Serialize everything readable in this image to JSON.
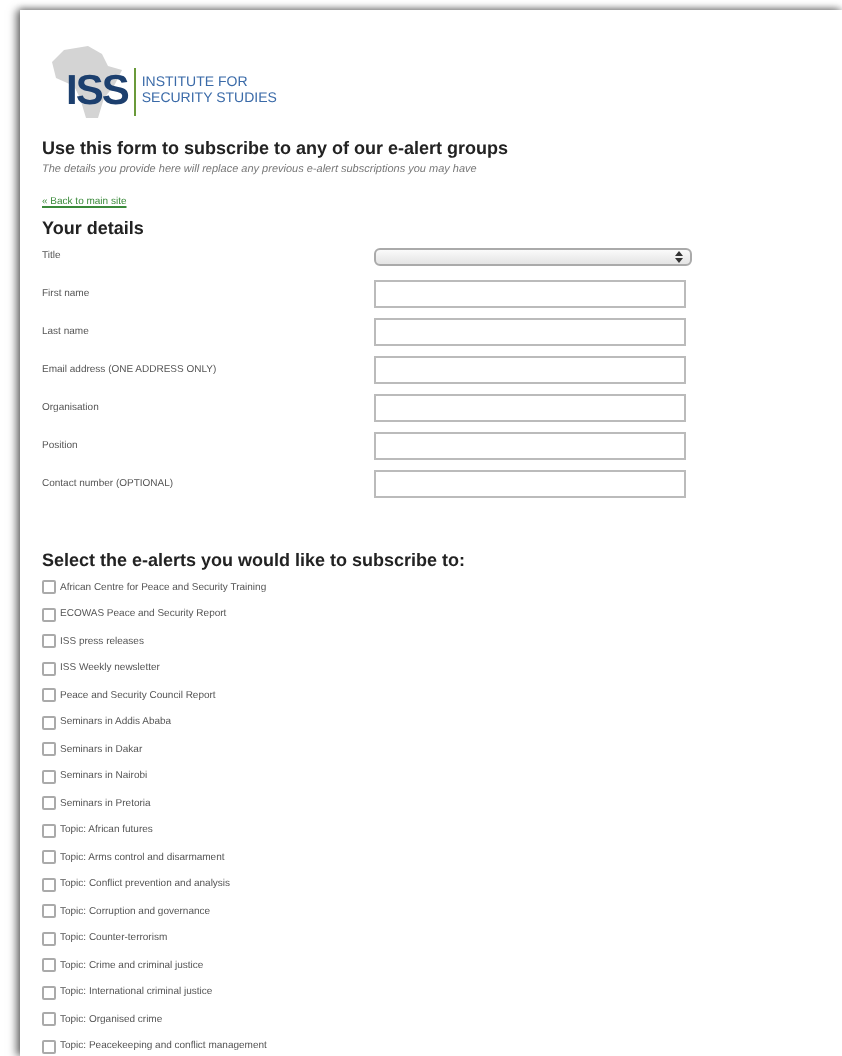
{
  "logo": {
    "abbr": "ISS",
    "line1": "INSTITUTE FOR",
    "line2": "SECURITY STUDIES"
  },
  "heading": "Use this form to subscribe to any of our e-alert groups",
  "intro": "The details you provide here will replace any previous e-alert subscriptions you may have",
  "back_link": "« Back to main site",
  "details_heading": "Your details",
  "fields": [
    {
      "label": "Title",
      "kind": "select"
    },
    {
      "label": "First name",
      "kind": "text"
    },
    {
      "label": "Last name",
      "kind": "text"
    },
    {
      "label": "Email address (ONE ADDRESS ONLY)",
      "kind": "text"
    },
    {
      "label": "Organisation",
      "kind": "text"
    },
    {
      "label": "Position",
      "kind": "text"
    },
    {
      "label": "Contact number (OPTIONAL)",
      "kind": "text"
    }
  ],
  "alerts_heading": "Select the e-alerts you would like to subscribe to:",
  "alerts": [
    {
      "label": "African Centre for Peace and Security Training",
      "checked": false
    },
    {
      "label": "ECOWAS Peace and Security Report",
      "checked": false
    },
    {
      "label": "ISS press releases",
      "checked": false
    },
    {
      "label": "ISS Weekly newsletter",
      "checked": false
    },
    {
      "label": "Peace and Security Council Report",
      "checked": false
    },
    {
      "label": "Seminars in Addis Ababa",
      "checked": false
    },
    {
      "label": "Seminars in Dakar",
      "checked": false
    },
    {
      "label": "Seminars in Nairobi",
      "checked": false
    },
    {
      "label": "Seminars in Pretoria",
      "checked": false
    },
    {
      "label": "Topic: African futures",
      "checked": false
    },
    {
      "label": "Topic: Arms control and disarmament",
      "checked": false
    },
    {
      "label": "Topic: Conflict prevention and analysis",
      "checked": false
    },
    {
      "label": "Topic: Corruption and governance",
      "checked": false
    },
    {
      "label": "Topic: Counter-terrorism",
      "checked": false
    },
    {
      "label": "Topic: Crime and criminal justice",
      "checked": false
    },
    {
      "label": "Topic: International criminal justice",
      "checked": false
    },
    {
      "label": "Topic: Organised crime",
      "checked": false
    },
    {
      "label": "Topic: Peacekeeping and conflict management",
      "checked": false
    }
  ]
}
